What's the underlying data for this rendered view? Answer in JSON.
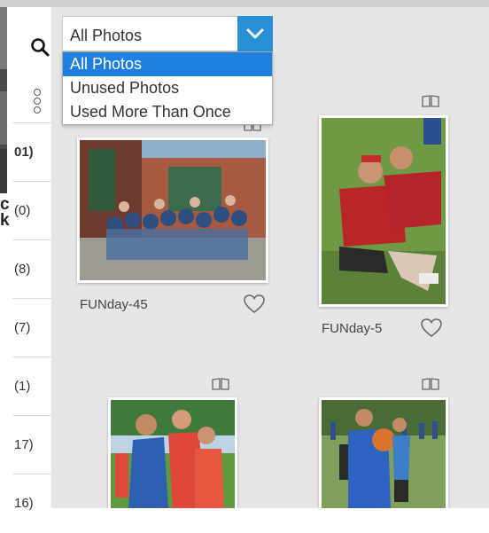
{
  "filter": {
    "selected": "All Photos",
    "options": [
      "All Photos",
      "Unused Photos",
      "Used More Than Once"
    ]
  },
  "sidebar": {
    "counts": [
      "01)",
      "(0)",
      "(8)",
      "(7)",
      "(1)",
      "17)",
      "16)"
    ]
  },
  "left_panel": {
    "cut_text": "c k"
  },
  "photos": [
    {
      "name": "FUNday-45",
      "favorite": false
    },
    {
      "name": "FUNday-5",
      "favorite": false
    },
    {
      "name": "",
      "favorite": false
    },
    {
      "name": "",
      "favorite": false
    }
  ],
  "colors": {
    "accent": "#2b8fd6",
    "selected_option": "#1f7fe0",
    "grid_background": "#e6e6e6"
  },
  "icons": [
    "search-icon",
    "more-options-icon",
    "book-icon",
    "heart-icon",
    "chevron-down-icon"
  ]
}
